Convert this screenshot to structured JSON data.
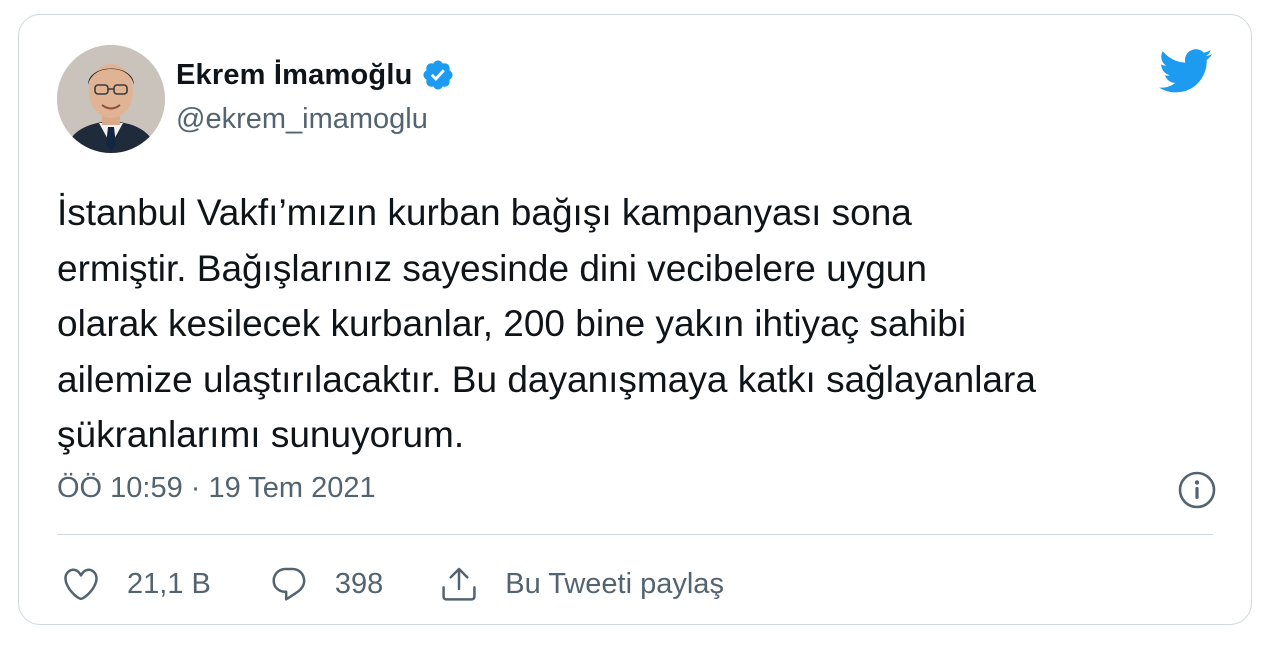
{
  "tweet": {
    "author": {
      "name": "Ekrem İmamoğlu",
      "handle": "@ekrem_imamoglu",
      "verified": true,
      "avatar_icon": "profile-photo"
    },
    "text": "İstanbul Vakfı’mızın kurban bağışı kampanyası sona\nermiştir. Bağışlarınız sayesinde dini vecibelere uygun\nolarak kesilecek kurbanlar, 200 bine yakın ihtiyaç sahibi\nailemize ulaştırılacaktır. Bu dayanışmaya katkı sağlayanlara\nşükranlarımı sunuyorum.",
    "timestamp": "ÖÖ 10:59 · 19 Tem 2021",
    "actions": {
      "like_count": "21,1 B",
      "reply_count": "398",
      "share_label": "Bu Tweeti paylaş"
    }
  },
  "icons": {
    "brand": "twitter-bird-icon",
    "verified": "verified-badge-icon",
    "info": "info-icon",
    "like": "heart-icon",
    "reply": "comment-icon",
    "share": "share-icon"
  },
  "colors": {
    "brand_blue": "#1d9bf0",
    "text_primary": "#0f1419",
    "text_secondary": "#536471",
    "border": "#cfd9de"
  }
}
